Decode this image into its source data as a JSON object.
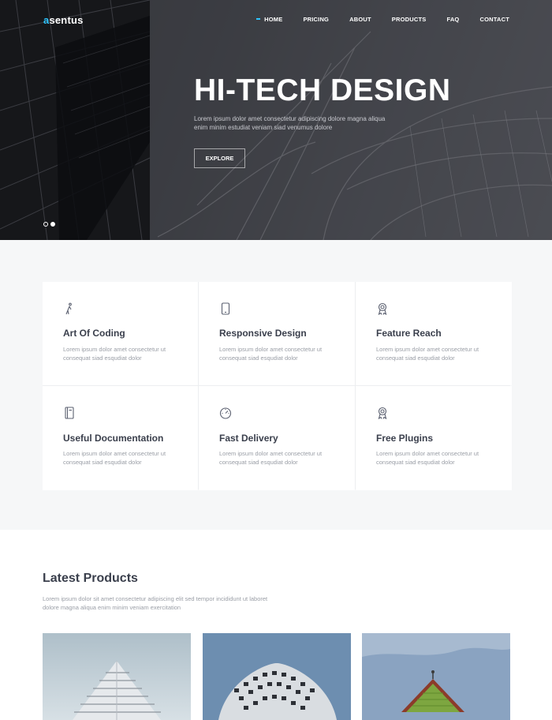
{
  "brand": {
    "accent_letter": "a",
    "rest": "sentus",
    "accent_color": "#2ec5ff"
  },
  "nav": {
    "items": [
      {
        "label": "HOME",
        "active": true
      },
      {
        "label": "PRICING"
      },
      {
        "label": "ABOUT"
      },
      {
        "label": "PRODUCTS"
      },
      {
        "label": "FAQ"
      },
      {
        "label": "CONTACT"
      }
    ]
  },
  "hero": {
    "title": "HI-TECH DESIGN",
    "subtitle": "Lorem ipsum dolor amet consectetur adipiscing dolore magna aliqua enim minim estudiat veniam siad venumus dolore",
    "button": "EXPLORE",
    "slides": 2,
    "active_slide": 2
  },
  "features": [
    {
      "icon": "figure-icon",
      "title": "Art Of Coding",
      "text": "Lorem ipsum dolor amet consectetur ut consequat siad esqudiat dolor"
    },
    {
      "icon": "phone-icon",
      "title": "Responsive Design",
      "text": "Lorem ipsum dolor amet consectetur ut consequat siad esqudiat dolor"
    },
    {
      "icon": "award-icon",
      "title": "Feature Reach",
      "text": "Lorem ipsum dolor amet consectetur ut consequat siad esqudiat dolor"
    },
    {
      "icon": "notebook-icon",
      "title": "Useful Documentation",
      "text": "Lorem ipsum dolor amet consectetur ut consequat siad esqudiat dolor"
    },
    {
      "icon": "speedometer-icon",
      "title": "Fast Delivery",
      "text": "Lorem ipsum dolor amet consectetur ut consequat siad esqudiat dolor"
    },
    {
      "icon": "award-icon",
      "title": "Free Plugins",
      "text": "Lorem ipsum dolor amet consectetur ut consequat siad esqudiat dolor"
    }
  ],
  "products": {
    "title": "Latest Products",
    "description": "Lorem ipsum dolor sit amet consectetur adipiscing elit sed tempor incididunt ut laboret dolore magna aliqua enim minim veniam exercitation"
  }
}
